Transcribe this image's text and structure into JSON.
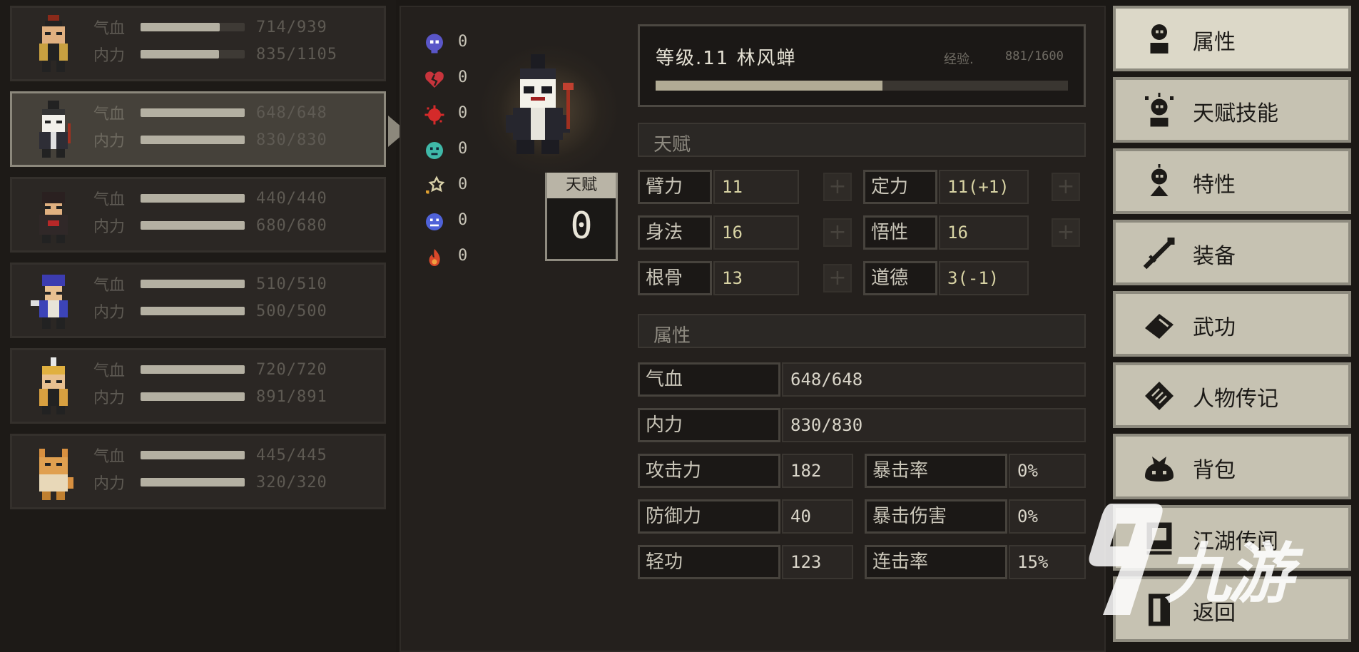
{
  "party": {
    "members": [
      {
        "hp_label": "气血",
        "hp": "714/939",
        "hp_frac": 0.76,
        "mp_label": "内力",
        "mp": "835/1105",
        "mp_frac": 0.755,
        "selected": false
      },
      {
        "hp_label": "气血",
        "hp": "648/648",
        "hp_frac": 1.0,
        "mp_label": "内力",
        "mp": "830/830",
        "mp_frac": 1.0,
        "selected": true
      },
      {
        "hp_label": "气血",
        "hp": "440/440",
        "hp_frac": 1.0,
        "mp_label": "内力",
        "mp": "680/680",
        "mp_frac": 1.0,
        "selected": false
      },
      {
        "hp_label": "气血",
        "hp": "510/510",
        "hp_frac": 1.0,
        "mp_label": "内力",
        "mp": "500/500",
        "mp_frac": 1.0,
        "selected": false
      },
      {
        "hp_label": "气血",
        "hp": "720/720",
        "hp_frac": 1.0,
        "mp_label": "内力",
        "mp": "891/891",
        "mp_frac": 1.0,
        "selected": false
      },
      {
        "hp_label": "气血",
        "hp": "445/445",
        "hp_frac": 1.0,
        "mp_label": "内力",
        "mp": "320/320",
        "mp_frac": 1.0,
        "selected": false
      }
    ]
  },
  "status_effects": [
    {
      "icon": "skull-icon",
      "color": "#5a56c8",
      "value": "0"
    },
    {
      "icon": "broken-heart-icon",
      "color": "#c8343c",
      "value": "0"
    },
    {
      "icon": "bleed-splat-icon",
      "color": "#d42a2a",
      "value": "0"
    },
    {
      "icon": "poison-face-icon",
      "color": "#3fb8a8",
      "value": "0"
    },
    {
      "icon": "stun-star-icon",
      "color": "#d8d0a8",
      "value": "0"
    },
    {
      "icon": "frost-face-icon",
      "color": "#4f62d8",
      "value": "0"
    },
    {
      "icon": "fire-icon",
      "color": "#d8482a",
      "value": "0"
    }
  ],
  "talent_points": {
    "label": "天赋",
    "value": "0"
  },
  "character": {
    "title": "等级.11 林风蝉",
    "exp_label": "经验.",
    "exp_value": "881/1600",
    "exp_frac": 0.55
  },
  "talent_section": {
    "title": "天赋"
  },
  "talents": {
    "arm": {
      "label": "臂力",
      "value": "11"
    },
    "focus": {
      "label": "定力",
      "value": "11(+1)"
    },
    "agility": {
      "label": "身法",
      "value": "16"
    },
    "insight": {
      "label": "悟性",
      "value": "16"
    },
    "bone": {
      "label": "根骨",
      "value": "13"
    },
    "morality": {
      "label": "道德",
      "value": "3(-1)"
    }
  },
  "attr_section": {
    "title": "属性"
  },
  "attributes": {
    "hp": {
      "label": "气血",
      "value": "648/648"
    },
    "mp": {
      "label": "内力",
      "value": "830/830"
    },
    "atk": {
      "label": "攻击力",
      "value": "182"
    },
    "crit_rate": {
      "label": "暴击率",
      "value": "0%"
    },
    "def": {
      "label": "防御力",
      "value": "40"
    },
    "crit_dmg": {
      "label": "暴击伤害",
      "value": "0%"
    },
    "lightness": {
      "label": "轻功",
      "value": "123"
    },
    "combo_rate": {
      "label": "连击率",
      "value": "15%"
    }
  },
  "menu": [
    {
      "label": "属性",
      "icon": "attribute-icon",
      "active": true
    },
    {
      "label": "天赋技能",
      "icon": "talent-skill-icon",
      "active": false
    },
    {
      "label": "特性",
      "icon": "trait-icon",
      "active": false
    },
    {
      "label": "装备",
      "icon": "sword-icon",
      "active": false
    },
    {
      "label": "武功",
      "icon": "martial-book-icon",
      "active": false
    },
    {
      "label": "人物传记",
      "icon": "biography-scroll-icon",
      "active": false
    },
    {
      "label": "背包",
      "icon": "bag-icon",
      "active": false
    },
    {
      "label": "江湖传闻",
      "icon": "rumor-board-icon",
      "active": false
    },
    {
      "label": "返回",
      "icon": "return-door-icon",
      "active": false
    }
  ],
  "watermark": {
    "text": "九游",
    "icon": "9you-logo-icon"
  },
  "colors": {
    "bg": "#1b1815",
    "bar_fill": "#b4b0a2",
    "value_yellow": "#d8d3a4",
    "menu_bg": "#c6c2b2"
  }
}
